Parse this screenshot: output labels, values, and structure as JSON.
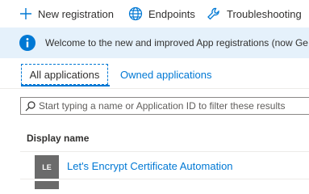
{
  "toolbar": {
    "new_registration": "New registration",
    "endpoints": "Endpoints",
    "troubleshooting": "Troubleshooting"
  },
  "banner": {
    "message": "Welcome to the new and improved App registrations (now Ge"
  },
  "tabs": {
    "all": "All applications",
    "owned": "Owned applications"
  },
  "search": {
    "placeholder": "Start typing a name or Application ID to filter these results"
  },
  "table": {
    "column": "Display name",
    "rows": [
      {
        "avatar": "LE",
        "name": "Let's Encrypt Certificate Automation"
      }
    ]
  },
  "colors": {
    "accent": "#0078d4",
    "banner_bg": "#e5f1fb",
    "avatar_bg": "#6b6b6b"
  }
}
